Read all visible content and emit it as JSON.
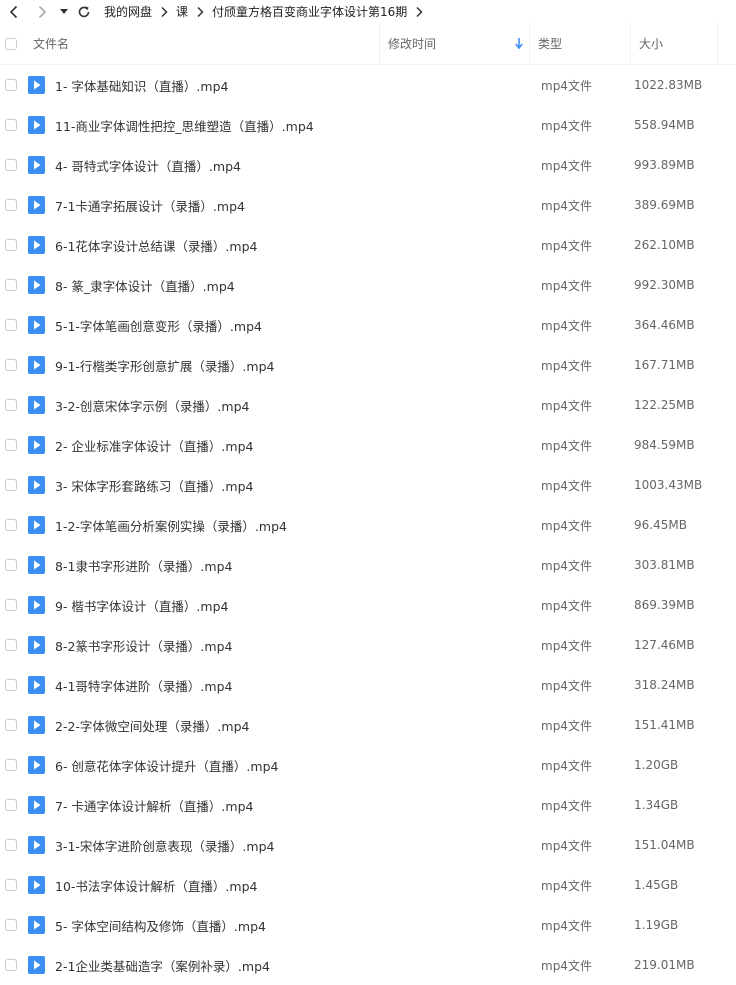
{
  "breadcrumb": [
    "我的网盘",
    "课",
    "付颀童方格百变商业字体设计第16期"
  ],
  "columns": {
    "name": "文件名",
    "modified": "修改时间",
    "type": "类型",
    "size": "大小"
  },
  "colors": {
    "accent": "#3b8ff2",
    "text": "#333333"
  },
  "files": [
    {
      "name": "1- 字体基础知识（直播）.mp4",
      "type": "mp4文件",
      "size": "1022.83MB"
    },
    {
      "name": "11-商业字体调性把控_思维塑造（直播）.mp4",
      "type": "mp4文件",
      "size": "558.94MB"
    },
    {
      "name": "4- 哥特式字体设计（直播）.mp4",
      "type": "mp4文件",
      "size": "993.89MB"
    },
    {
      "name": "7-1卡通字拓展设计（录播）.mp4",
      "type": "mp4文件",
      "size": "389.69MB"
    },
    {
      "name": "6-1花体字设计总结课（录播）.mp4",
      "type": "mp4文件",
      "size": "262.10MB"
    },
    {
      "name": "8- 篆_隶字体设计（直播）.mp4",
      "type": "mp4文件",
      "size": "992.30MB"
    },
    {
      "name": "5-1-字体笔画创意变形（录播）.mp4",
      "type": "mp4文件",
      "size": "364.46MB"
    },
    {
      "name": "9-1-行楷类字形创意扩展（录播）.mp4",
      "type": "mp4文件",
      "size": "167.71MB"
    },
    {
      "name": "3-2-创意宋体字示例（录播）.mp4",
      "type": "mp4文件",
      "size": "122.25MB"
    },
    {
      "name": "2- 企业标准字体设计（直播）.mp4",
      "type": "mp4文件",
      "size": "984.59MB"
    },
    {
      "name": "3- 宋体字形套路练习（直播）.mp4",
      "type": "mp4文件",
      "size": "1003.43MB"
    },
    {
      "name": "1-2-字体笔画分析案例实操（录播）.mp4",
      "type": "mp4文件",
      "size": "96.45MB"
    },
    {
      "name": "8-1隶书字形进阶（录播）.mp4",
      "type": "mp4文件",
      "size": "303.81MB"
    },
    {
      "name": "9- 楷书字体设计（直播）.mp4",
      "type": "mp4文件",
      "size": "869.39MB"
    },
    {
      "name": "8-2篆书字形设计（录播）.mp4",
      "type": "mp4文件",
      "size": "127.46MB"
    },
    {
      "name": "4-1哥特字体进阶（录播）.mp4",
      "type": "mp4文件",
      "size": "318.24MB"
    },
    {
      "name": "2-2-字体微空间处理（录播）.mp4",
      "type": "mp4文件",
      "size": "151.41MB"
    },
    {
      "name": "6- 创意花体字体设计提升（直播）.mp4",
      "type": "mp4文件",
      "size": "1.20GB"
    },
    {
      "name": "7- 卡通字体设计解析（直播）.mp4",
      "type": "mp4文件",
      "size": "1.34GB"
    },
    {
      "name": "3-1-宋体字进阶创意表现（录播）.mp4",
      "type": "mp4文件",
      "size": "151.04MB"
    },
    {
      "name": "10-书法字体设计解析（直播）.mp4",
      "type": "mp4文件",
      "size": "1.45GB"
    },
    {
      "name": "5- 字体空间结构及修饰（直播）.mp4",
      "type": "mp4文件",
      "size": "1.19GB"
    },
    {
      "name": "2-1企业类基础造字（案例补录）.mp4",
      "type": "mp4文件",
      "size": "219.01MB"
    }
  ]
}
